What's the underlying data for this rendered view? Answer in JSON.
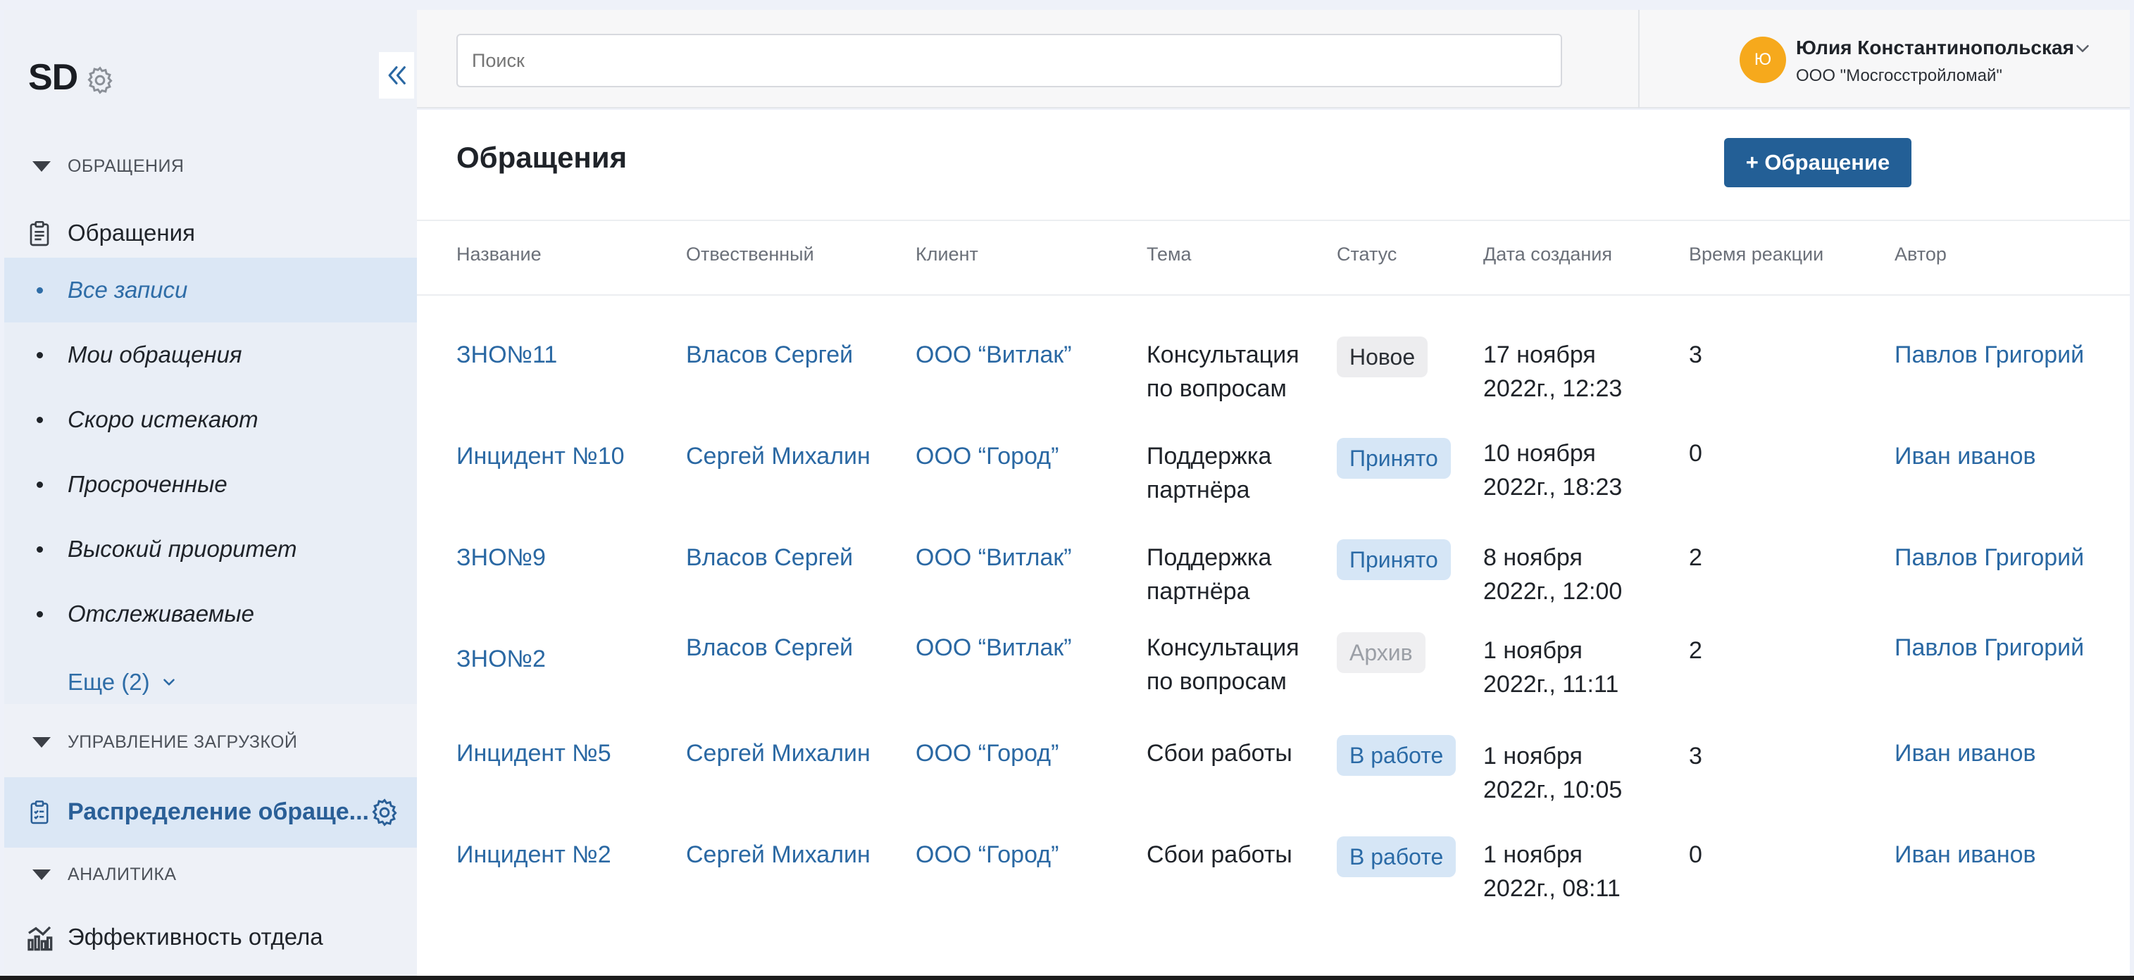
{
  "sidebar": {
    "logo": "SD",
    "sections": [
      {
        "label": "ОБРАЩЕНИЯ"
      },
      {
        "label": "УПРАВЛЕНИЕ ЗАГРУЗКОЙ"
      },
      {
        "label": "АНАЛИТИКА"
      }
    ],
    "main_item": "Обращения",
    "sub_items": [
      {
        "label": "Все записи",
        "active": true
      },
      {
        "label": "Мои обращения"
      },
      {
        "label": "Скоро истекают"
      },
      {
        "label": "Просроченные"
      },
      {
        "label": "Высокий приоритет"
      },
      {
        "label": "Отслеживаемые"
      }
    ],
    "more": "Еще (2)",
    "distribution": "Распределение обраще...",
    "analytics_item": "Эффективность отдела"
  },
  "header": {
    "search_placeholder": "Поиск",
    "avatar_initial": "Ю",
    "user_name": "Юлия Константинопольская",
    "user_org": "ООО \"Мосгосстройломай\""
  },
  "main": {
    "title": "Обращения",
    "new_button": "+ Обращение",
    "columns": [
      "Название",
      "Отвественный",
      "Клиент",
      "Тема",
      "Статус",
      "Дата создания",
      "Время реакции",
      "Автор"
    ],
    "rows": [
      {
        "name": "ЗНО№11",
        "responsible": "Власов Сергей",
        "client": "ООО “Витлак”",
        "topic1": "Консультация",
        "topic2": "по вопросам",
        "status": "Новое",
        "date1": "17 ноября",
        "date2": "2022г., 12:23",
        "reaction": "3",
        "author": "Павлов Григорий"
      },
      {
        "name": "Инцидент №10",
        "responsible": "Сергей Михалин",
        "client": "ООО “Город”",
        "topic1": "Поддержка",
        "topic2": "партнёра",
        "status": "Принято",
        "date1": "10 ноября",
        "date2": "2022г., 18:23",
        "reaction": "0",
        "author": "Иван иванов"
      },
      {
        "name": "ЗНО№9",
        "responsible": "Власов Сергей",
        "client": "ООО “Витлак”",
        "topic1": "Поддержка",
        "topic2": "партнёра",
        "status": "Принято",
        "date1": "8 ноября",
        "date2": "2022г., 12:00",
        "reaction": "2",
        "author": "Павлов Григорий"
      },
      {
        "name": "ЗНО№2",
        "responsible": "Власов Сергей",
        "client": "ООО “Витлак”",
        "topic1": "Консультация",
        "topic2": "по вопросам",
        "status": "Архив",
        "date1": "1 ноября",
        "date2": "2022г., 11:11",
        "reaction": "2",
        "author": "Павлов Григорий"
      },
      {
        "name": "Инцидент №5",
        "responsible": "Сергей Михалин",
        "client": "ООО “Город”",
        "topic1": "Сбои работы",
        "topic2": "",
        "status": "В работе",
        "date1": "1 ноября",
        "date2": "2022г., 10:05",
        "reaction": "3",
        "author": "Иван иванов"
      },
      {
        "name": "Инцидент №2",
        "responsible": "Сергей Михалин",
        "client": "ООО “Город”",
        "topic1": "Сбои работы",
        "topic2": "",
        "status": "В работе",
        "date1": "1 ноября",
        "date2": "2022г., 08:11",
        "reaction": "0",
        "author": "Иван иванов"
      }
    ]
  },
  "colors": {
    "accent": "#235f96",
    "link": "#2a68a3",
    "avatar": "#f6a91c",
    "sidebar_active": "#dbe7f5"
  }
}
